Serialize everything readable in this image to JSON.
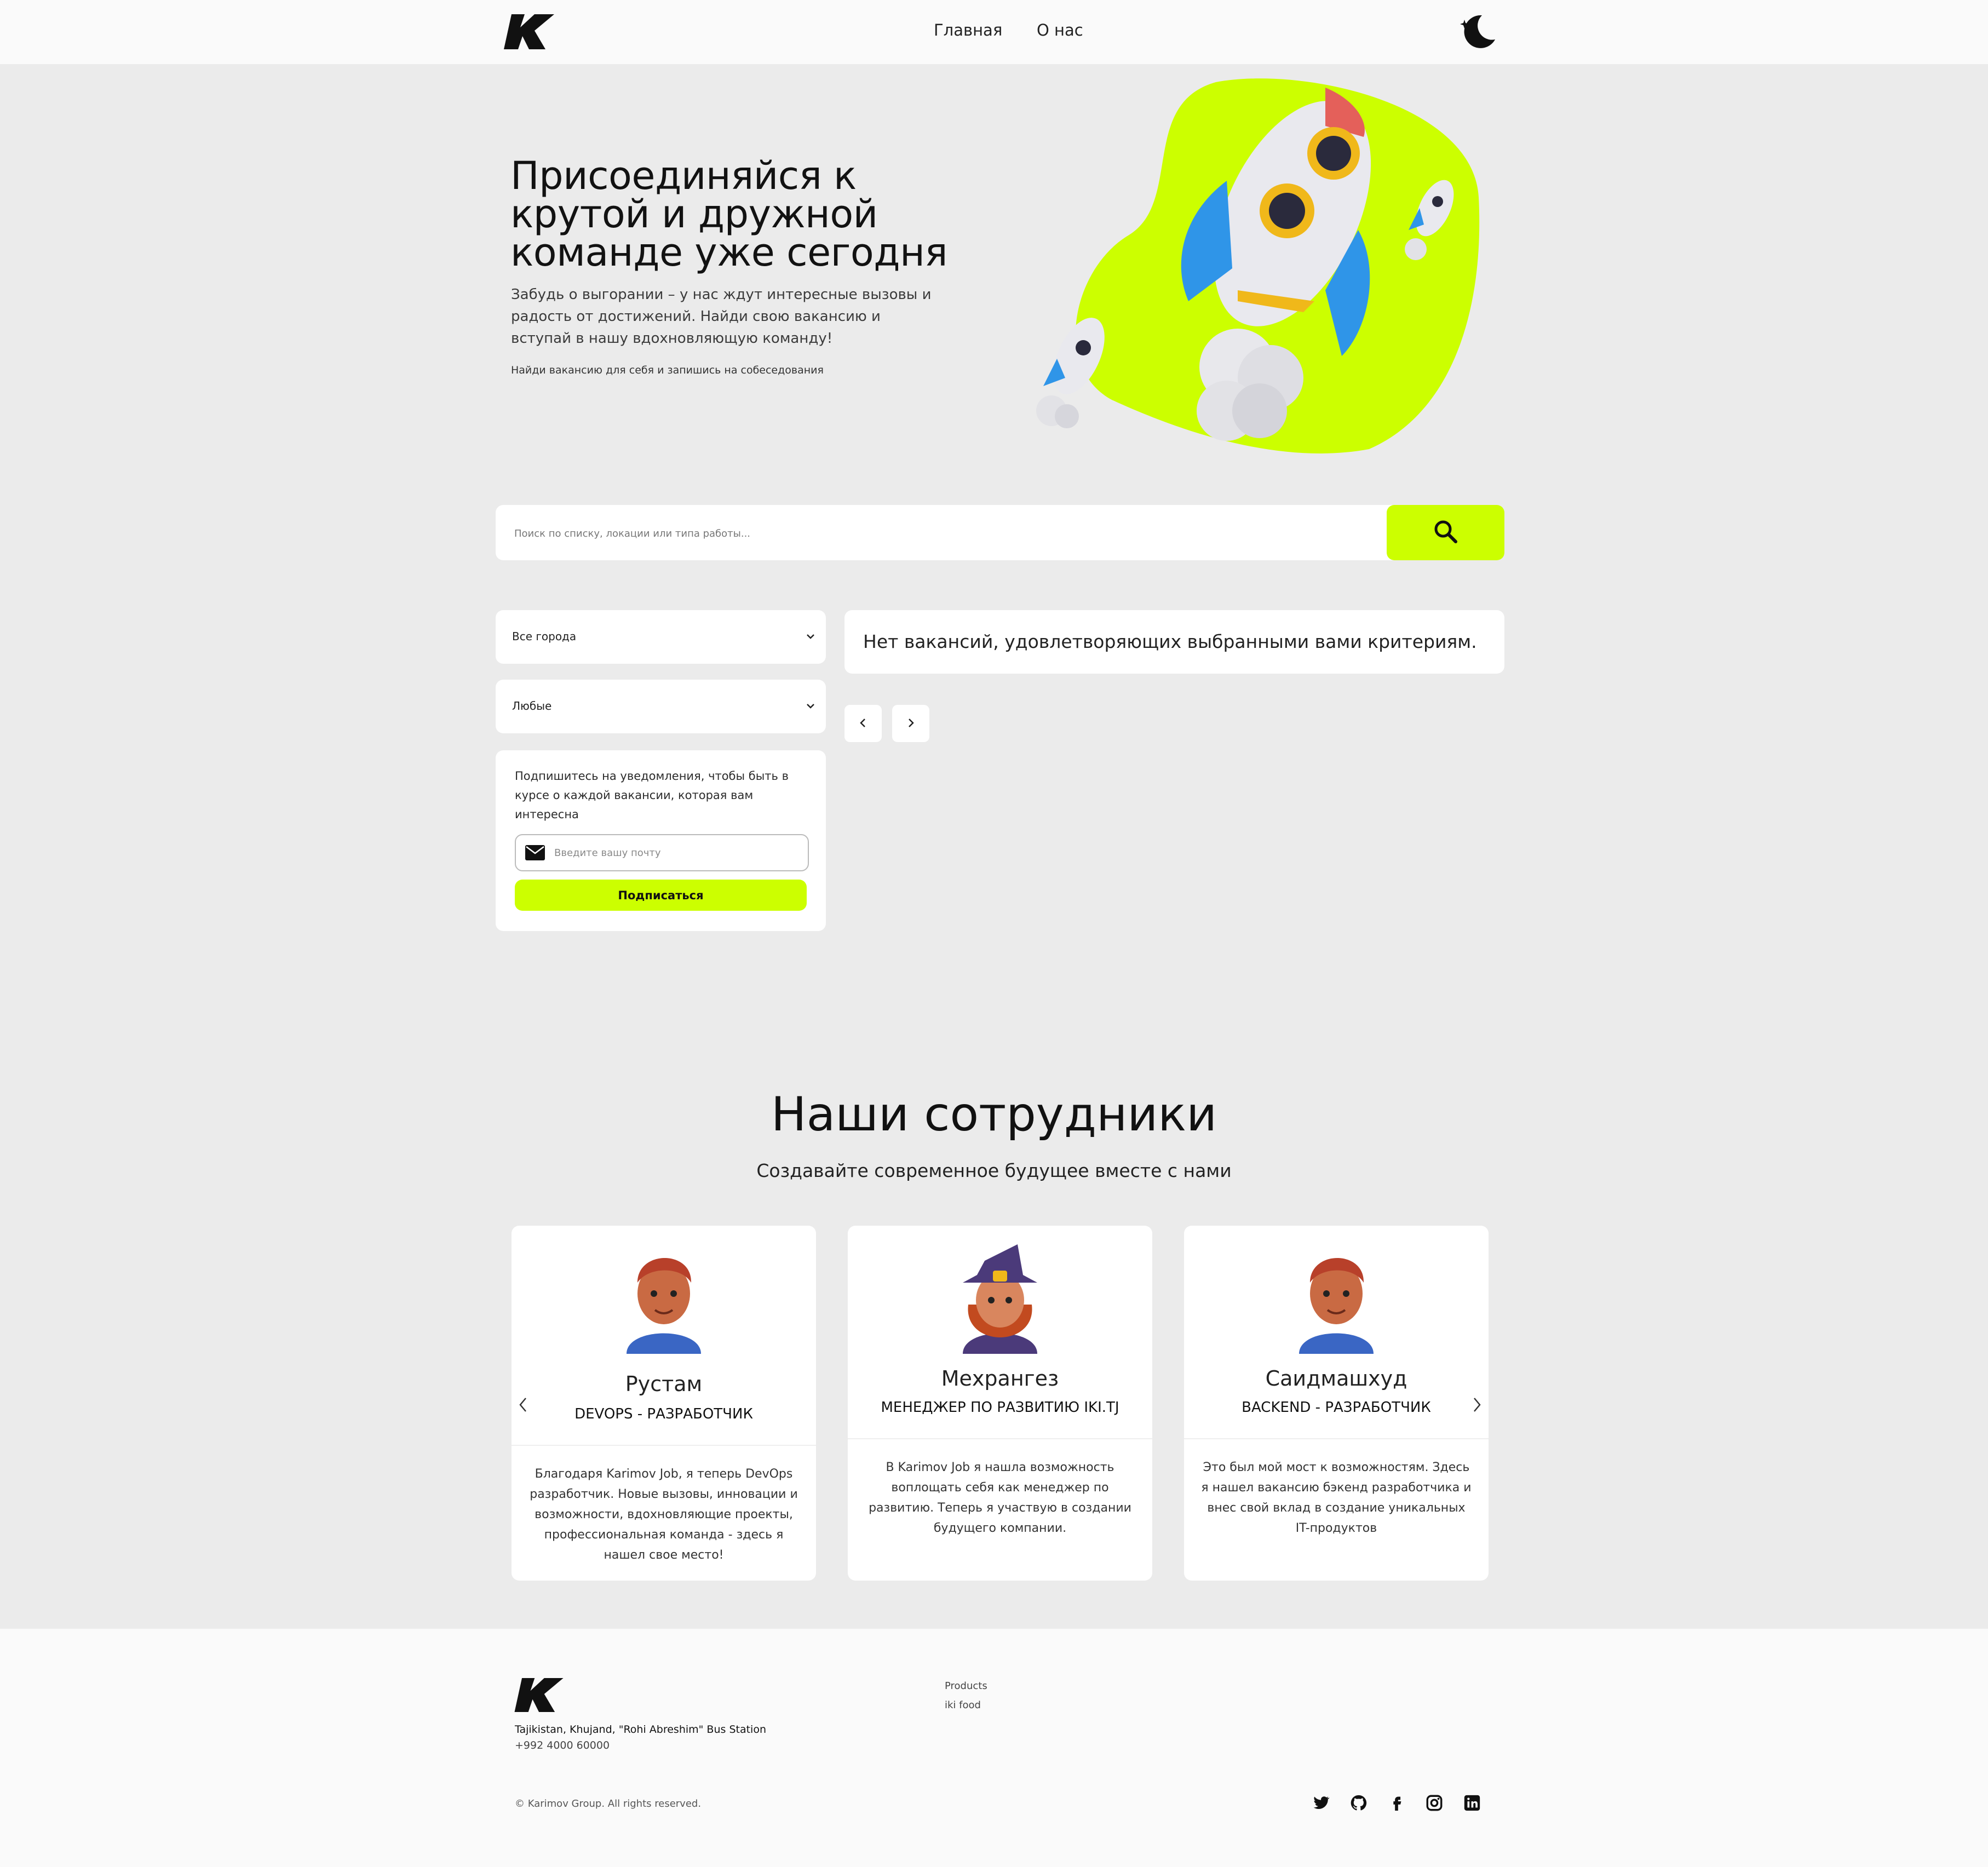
{
  "header": {
    "logo_icon": "brand-k-logo",
    "nav": [
      "Главная",
      "О нас"
    ],
    "theme_toggle_icon": "moon-star-icon"
  },
  "hero": {
    "title": "Присоединяйся к крутой и дружной команде уже сегодня",
    "text": "Забудь о выгорании – у нас ждут интересные вызовы и радость от достижений. Найди свою вакансию и вступай в нашу вдохновляющую команду!",
    "small": "Найди вакансию для себя и запишись на собеседования",
    "illustration": "rocket-illustration",
    "accent": "#ccff00"
  },
  "search": {
    "placeholder": "Поиск по списку, локации или типа работы...",
    "button_icon": "search-icon"
  },
  "filters": {
    "city": "Все города",
    "type": "Любые"
  },
  "subscribe": {
    "text": "Подпишитесь на уведомления, чтобы быть в курсе о каждой вакансии, которая вам интересна",
    "email_placeholder": "Введите вашу почту",
    "button": "Подписаться"
  },
  "jobs": {
    "empty_message": "Нет вакансий, удовлетворяющих выбранными вами критериям."
  },
  "team": {
    "title": "Наши сотрудники",
    "subtitle": "Создавайте современное будущее вместе с нами",
    "members": [
      {
        "name": "Рустам",
        "role": "DEVOPS - РАЗРАБОТЧИК",
        "quote": "Благодаря Karimov Job, я теперь DevOps разработчик. Новые вызовы, инновации и возможности, вдохновляющие проекты, профессиональная команда - здесь я нашел свое место!"
      },
      {
        "name": "Мехрангез",
        "role": "МЕНЕДЖЕР ПО РАЗВИТИЮ IKI.TJ",
        "quote": "В Karimov Job я нашла возможность воплощать себя как менеджер по развитию. Теперь я участвую в создании будущего компании."
      },
      {
        "name": "Саидмашхуд",
        "role": "BACKEND - РАЗРАБОТЧИК",
        "quote": "Это был мой мост к возможностям. Здесь я нашел вакансию бэкенд разработчика и внес свой вклад в создание уникальных IT-продуктов"
      }
    ]
  },
  "footer": {
    "address": "Tajikistan, Khujand, \"Rohi Abreshim\" Bus Station",
    "phone": "+992 4000 60000",
    "links": [
      "Products",
      "iki food"
    ],
    "copyright": "© Karimov Group. All rights reserved.",
    "social": [
      "twitter-icon",
      "github-icon",
      "facebook-icon",
      "instagram-icon",
      "linkedin-icon"
    ]
  }
}
